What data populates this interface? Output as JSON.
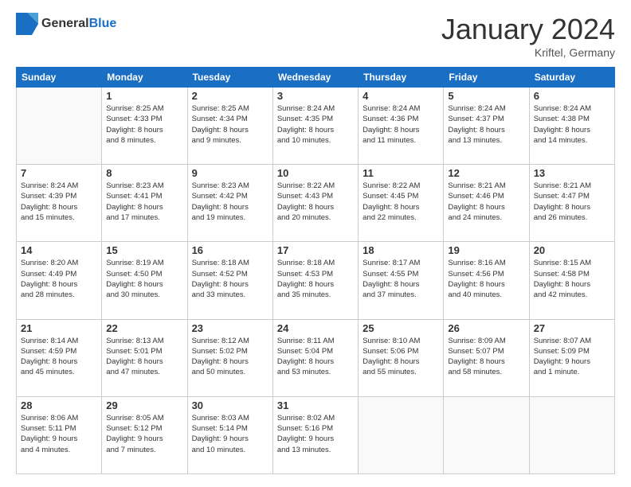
{
  "header": {
    "logo_general": "General",
    "logo_blue": "Blue",
    "month_title": "January 2024",
    "location": "Kriftel, Germany"
  },
  "calendar": {
    "days_of_week": [
      "Sunday",
      "Monday",
      "Tuesday",
      "Wednesday",
      "Thursday",
      "Friday",
      "Saturday"
    ],
    "weeks": [
      [
        {
          "day": "",
          "info": ""
        },
        {
          "day": "1",
          "info": "Sunrise: 8:25 AM\nSunset: 4:33 PM\nDaylight: 8 hours\nand 8 minutes."
        },
        {
          "day": "2",
          "info": "Sunrise: 8:25 AM\nSunset: 4:34 PM\nDaylight: 8 hours\nand 9 minutes."
        },
        {
          "day": "3",
          "info": "Sunrise: 8:24 AM\nSunset: 4:35 PM\nDaylight: 8 hours\nand 10 minutes."
        },
        {
          "day": "4",
          "info": "Sunrise: 8:24 AM\nSunset: 4:36 PM\nDaylight: 8 hours\nand 11 minutes."
        },
        {
          "day": "5",
          "info": "Sunrise: 8:24 AM\nSunset: 4:37 PM\nDaylight: 8 hours\nand 13 minutes."
        },
        {
          "day": "6",
          "info": "Sunrise: 8:24 AM\nSunset: 4:38 PM\nDaylight: 8 hours\nand 14 minutes."
        }
      ],
      [
        {
          "day": "7",
          "info": "Sunrise: 8:24 AM\nSunset: 4:39 PM\nDaylight: 8 hours\nand 15 minutes."
        },
        {
          "day": "8",
          "info": "Sunrise: 8:23 AM\nSunset: 4:41 PM\nDaylight: 8 hours\nand 17 minutes."
        },
        {
          "day": "9",
          "info": "Sunrise: 8:23 AM\nSunset: 4:42 PM\nDaylight: 8 hours\nand 19 minutes."
        },
        {
          "day": "10",
          "info": "Sunrise: 8:22 AM\nSunset: 4:43 PM\nDaylight: 8 hours\nand 20 minutes."
        },
        {
          "day": "11",
          "info": "Sunrise: 8:22 AM\nSunset: 4:45 PM\nDaylight: 8 hours\nand 22 minutes."
        },
        {
          "day": "12",
          "info": "Sunrise: 8:21 AM\nSunset: 4:46 PM\nDaylight: 8 hours\nand 24 minutes."
        },
        {
          "day": "13",
          "info": "Sunrise: 8:21 AM\nSunset: 4:47 PM\nDaylight: 8 hours\nand 26 minutes."
        }
      ],
      [
        {
          "day": "14",
          "info": "Sunrise: 8:20 AM\nSunset: 4:49 PM\nDaylight: 8 hours\nand 28 minutes."
        },
        {
          "day": "15",
          "info": "Sunrise: 8:19 AM\nSunset: 4:50 PM\nDaylight: 8 hours\nand 30 minutes."
        },
        {
          "day": "16",
          "info": "Sunrise: 8:18 AM\nSunset: 4:52 PM\nDaylight: 8 hours\nand 33 minutes."
        },
        {
          "day": "17",
          "info": "Sunrise: 8:18 AM\nSunset: 4:53 PM\nDaylight: 8 hours\nand 35 minutes."
        },
        {
          "day": "18",
          "info": "Sunrise: 8:17 AM\nSunset: 4:55 PM\nDaylight: 8 hours\nand 37 minutes."
        },
        {
          "day": "19",
          "info": "Sunrise: 8:16 AM\nSunset: 4:56 PM\nDaylight: 8 hours\nand 40 minutes."
        },
        {
          "day": "20",
          "info": "Sunrise: 8:15 AM\nSunset: 4:58 PM\nDaylight: 8 hours\nand 42 minutes."
        }
      ],
      [
        {
          "day": "21",
          "info": "Sunrise: 8:14 AM\nSunset: 4:59 PM\nDaylight: 8 hours\nand 45 minutes."
        },
        {
          "day": "22",
          "info": "Sunrise: 8:13 AM\nSunset: 5:01 PM\nDaylight: 8 hours\nand 47 minutes."
        },
        {
          "day": "23",
          "info": "Sunrise: 8:12 AM\nSunset: 5:02 PM\nDaylight: 8 hours\nand 50 minutes."
        },
        {
          "day": "24",
          "info": "Sunrise: 8:11 AM\nSunset: 5:04 PM\nDaylight: 8 hours\nand 53 minutes."
        },
        {
          "day": "25",
          "info": "Sunrise: 8:10 AM\nSunset: 5:06 PM\nDaylight: 8 hours\nand 55 minutes."
        },
        {
          "day": "26",
          "info": "Sunrise: 8:09 AM\nSunset: 5:07 PM\nDaylight: 8 hours\nand 58 minutes."
        },
        {
          "day": "27",
          "info": "Sunrise: 8:07 AM\nSunset: 5:09 PM\nDaylight: 9 hours\nand 1 minute."
        }
      ],
      [
        {
          "day": "28",
          "info": "Sunrise: 8:06 AM\nSunset: 5:11 PM\nDaylight: 9 hours\nand 4 minutes."
        },
        {
          "day": "29",
          "info": "Sunrise: 8:05 AM\nSunset: 5:12 PM\nDaylight: 9 hours\nand 7 minutes."
        },
        {
          "day": "30",
          "info": "Sunrise: 8:03 AM\nSunset: 5:14 PM\nDaylight: 9 hours\nand 10 minutes."
        },
        {
          "day": "31",
          "info": "Sunrise: 8:02 AM\nSunset: 5:16 PM\nDaylight: 9 hours\nand 13 minutes."
        },
        {
          "day": "",
          "info": ""
        },
        {
          "day": "",
          "info": ""
        },
        {
          "day": "",
          "info": ""
        }
      ]
    ]
  }
}
